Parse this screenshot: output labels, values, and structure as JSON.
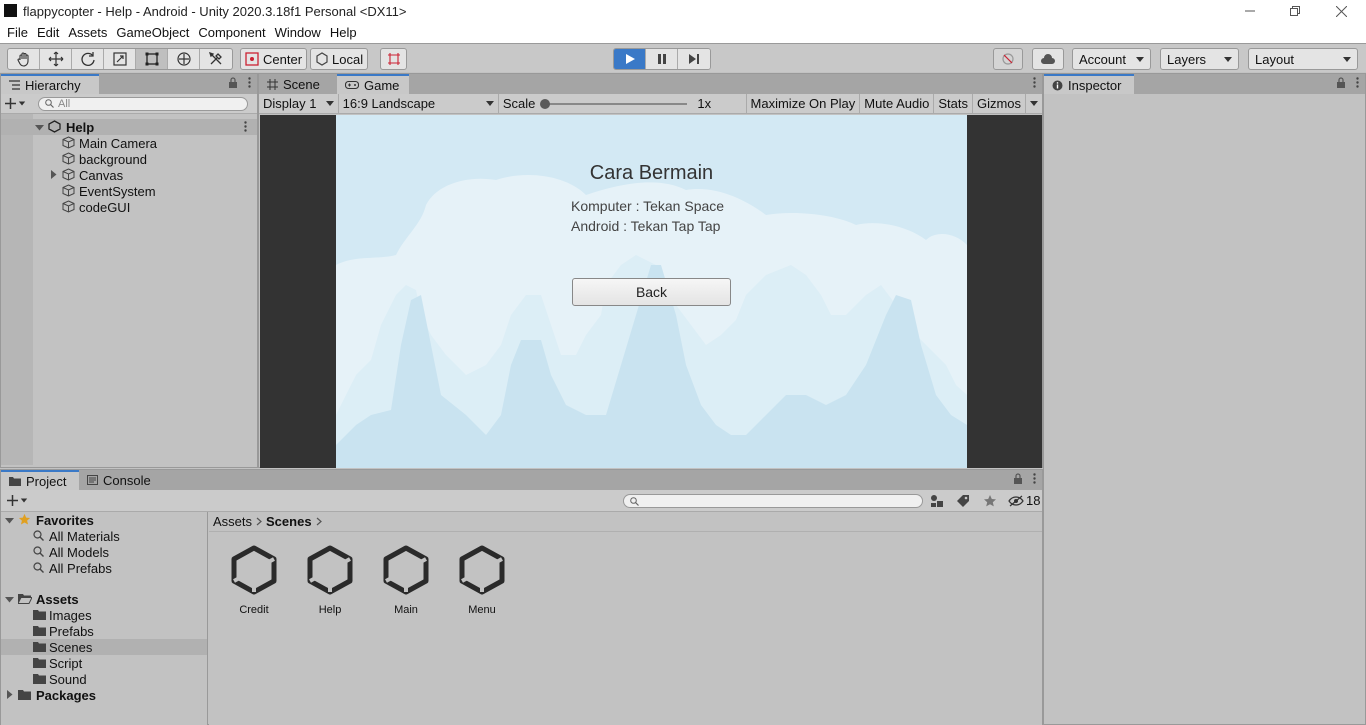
{
  "window": {
    "title": "flappycopter - Help - Android - Unity 2020.3.18f1 Personal <DX11>"
  },
  "menu": [
    "File",
    "Edit",
    "Assets",
    "GameObject",
    "Component",
    "Window",
    "Help"
  ],
  "toolbar": {
    "pivot": "Center",
    "space": "Local",
    "account": "Account",
    "layers": "Layers",
    "layout": "Layout"
  },
  "hierarchy": {
    "tab": "Hierarchy",
    "search_placeholder": "All",
    "scene": "Help",
    "items": [
      "Main Camera",
      "background",
      "Canvas",
      "EventSystem",
      "codeGUI"
    ]
  },
  "game_panel": {
    "tabs": [
      "Scene",
      "Game"
    ],
    "display": "Display 1",
    "aspect": "16:9 Landscape",
    "scale_label": "Scale",
    "scale_value": "1x",
    "maximize": "Maximize On Play",
    "mute": "Mute Audio",
    "stats": "Stats",
    "gizmos": "Gizmos"
  },
  "game_content": {
    "title": "Cara Bermain",
    "line1": "Komputer : Tekan Space",
    "line2": "Android : Tekan Tap Tap",
    "back_button": "Back"
  },
  "inspector": {
    "tab": "Inspector"
  },
  "project": {
    "tabs": [
      "Project",
      "Console"
    ],
    "hidden_count": "18",
    "favorites": {
      "label": "Favorites",
      "items": [
        "All Materials",
        "All Models",
        "All Prefabs"
      ]
    },
    "assets": {
      "label": "Assets",
      "folders": [
        "Images",
        "Prefabs",
        "Scenes",
        "Script",
        "Sound"
      ]
    },
    "packages": "Packages",
    "breadcrumb": [
      "Assets",
      "Scenes"
    ],
    "scene_files": [
      "Credit",
      "Help",
      "Main",
      "Menu"
    ]
  },
  "colors": {
    "accent": "#3a79c7",
    "game_sky": "#d3e9f4",
    "panel_bg": "#c2c2c2"
  }
}
